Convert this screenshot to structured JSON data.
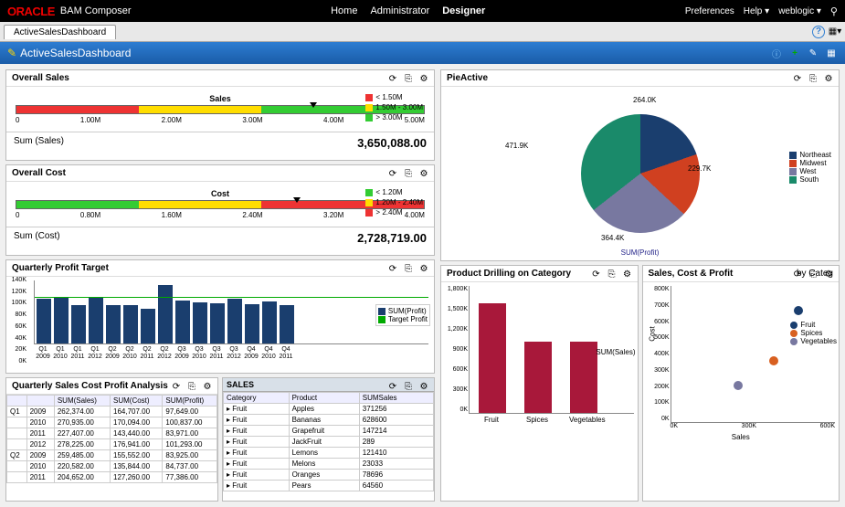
{
  "header": {
    "brand": "ORACLE",
    "product": "BAM Composer",
    "nav": [
      "Home",
      "Administrator",
      "Designer"
    ],
    "nav_active": 2,
    "right": {
      "prefs": "Preferences",
      "help": "Help",
      "user": "weblogic"
    }
  },
  "tab": {
    "name": "ActiveSalesDashboard"
  },
  "title": "ActiveSalesDashboard",
  "overall_sales": {
    "hdr": "Overall Sales",
    "gauge_title": "Sales",
    "ticks": [
      "0",
      "1.00M",
      "2.00M",
      "3.00M",
      "4.00M",
      "5.00M"
    ],
    "legend": [
      {
        "color": "#e33",
        "label": "< 1.50M"
      },
      {
        "color": "#fd0",
        "label": "1.50M - 3.00M"
      },
      {
        "color": "#3c3",
        "label": "> 3.00M"
      }
    ],
    "sum_lbl": "Sum (Sales)",
    "sum_val": "3,650,088.00"
  },
  "overall_cost": {
    "hdr": "Overall Cost",
    "gauge_title": "Cost",
    "ticks": [
      "0",
      "0.80M",
      "1.60M",
      "2.40M",
      "3.20M",
      "4.00M"
    ],
    "legend": [
      {
        "color": "#3c3",
        "label": "< 1.20M"
      },
      {
        "color": "#fd0",
        "label": "1.20M - 2.40M"
      },
      {
        "color": "#e33",
        "label": "> 2.40M"
      }
    ],
    "sum_lbl": "Sum (Cost)",
    "sum_val": "2,728,719.00"
  },
  "quarterly_profit": {
    "hdr": "Quarterly Profit Target",
    "legend": [
      {
        "color": "#1a3e6e",
        "label": "SUM(Profit)"
      },
      {
        "color": "#0a0",
        "label": "Target Profit"
      }
    ]
  },
  "qscp": {
    "hdr": "Quarterly Sales Cost Profit Analysis",
    "cols": [
      "",
      "",
      "SUM(Sales)",
      "SUM(Cost)",
      "SUM(Profit)"
    ],
    "rows": [
      [
        "Q1",
        "2009",
        "262,374.00",
        "164,707.00",
        "97,649.00"
      ],
      [
        "",
        "2010",
        "270,935.00",
        "170,094.00",
        "100,837.00"
      ],
      [
        "",
        "2011",
        "227,407.00",
        "143,440.00",
        "83,971.00"
      ],
      [
        "",
        "2012",
        "278,225.00",
        "176,941.00",
        "101,293.00"
      ],
      [
        "Q2",
        "2009",
        "259,485.00",
        "155,552.00",
        "83,925.00"
      ],
      [
        "",
        "2010",
        "220,582.00",
        "135,844.00",
        "84,737.00"
      ],
      [
        "",
        "2011",
        "204,652.00",
        "127,260.00",
        "77,386.00"
      ]
    ]
  },
  "sales_tbl": {
    "hdr": "SALES",
    "cols": [
      "Category",
      "Product",
      "SUMSales"
    ],
    "rows": [
      [
        "Fruit",
        "Apples",
        "371256"
      ],
      [
        "Fruit",
        "Bananas",
        "628600"
      ],
      [
        "Fruit",
        "Grapefruit",
        "147214"
      ],
      [
        "Fruit",
        "JackFruit",
        "289"
      ],
      [
        "Fruit",
        "Lemons",
        "121410"
      ],
      [
        "Fruit",
        "Melons",
        "23033"
      ],
      [
        "Fruit",
        "Oranges",
        "78696"
      ],
      [
        "Fruit",
        "Pears",
        "64560"
      ]
    ]
  },
  "pie": {
    "hdr": "PieActive",
    "sub": "SUM(Profit)",
    "labels": {
      "ne": "264.0K",
      "mw": "229.7K",
      "w": "364.4K",
      "s": "471.9K"
    },
    "legend": [
      {
        "color": "#1a3e6e",
        "label": "Northeast"
      },
      {
        "color": "#d04020",
        "label": "Midwest"
      },
      {
        "color": "#7878a0",
        "label": "West"
      },
      {
        "color": "#1a8a6a",
        "label": "South"
      }
    ]
  },
  "drill": {
    "hdr": "Product Drilling on Category",
    "yticks": [
      "1,800K",
      "1,500K",
      "1,200K",
      "900K",
      "600K",
      "300K",
      "0K"
    ],
    "legend": {
      "color": "#a8183a",
      "label": "SUM(Sales)"
    },
    "xlabels": [
      "Fruit",
      "Spices",
      "Vegetables"
    ]
  },
  "scatter": {
    "hdr": "Sales, Cost & Profit",
    "hdr2": "by Categ",
    "yticks": [
      "800K",
      "700K",
      "600K",
      "500K",
      "400K",
      "300K",
      "200K",
      "100K",
      "0K"
    ],
    "xticks": [
      "0K",
      "300K",
      "600K"
    ],
    "ylabel": "Cost",
    "xlabel": "Sales",
    "legend": [
      {
        "color": "#1a3e6e",
        "label": "Fruit"
      },
      {
        "color": "#d86020",
        "label": "Spices"
      },
      {
        "color": "#7878a0",
        "label": "Vegetables"
      }
    ]
  },
  "chart_data": [
    {
      "type": "bar",
      "title": "Quarterly Profit Target",
      "ylim": [
        0,
        140
      ],
      "target": 100,
      "categories": [
        "Q1 2009",
        "Q1 2010",
        "Q1 2011",
        "Q1 2012",
        "Q2 2009",
        "Q2 2010",
        "Q2 2011",
        "Q2 2012",
        "Q3 2009",
        "Q3 2010",
        "Q3 2011",
        "Q3 2012",
        "Q4 2009",
        "Q4 2010",
        "Q4 2011"
      ],
      "series": [
        {
          "name": "SUM(Profit)",
          "values": [
            98,
            101,
            84,
            101,
            84,
            85,
            77,
            128,
            94,
            90,
            88,
            99,
            86,
            92,
            84
          ]
        },
        {
          "name": "Target Profit",
          "values": [
            100,
            100,
            100,
            100,
            100,
            100,
            100,
            100,
            100,
            100,
            100,
            100,
            100,
            100,
            100
          ]
        }
      ]
    },
    {
      "type": "pie",
      "title": "PieActive",
      "series": [
        {
          "name": "SUM(Profit)",
          "values": [
            {
              "name": "Northeast",
              "value": 264.0
            },
            {
              "name": "Midwest",
              "value": 229.7
            },
            {
              "name": "West",
              "value": 364.4
            },
            {
              "name": "South",
              "value": 471.9
            }
          ]
        }
      ]
    },
    {
      "type": "bar",
      "title": "Product Drilling on Category",
      "ylim": [
        0,
        1800
      ],
      "categories": [
        "Fruit",
        "Spices",
        "Vegetables"
      ],
      "series": [
        {
          "name": "SUM(Sales)",
          "values": [
            1550,
            1000,
            1000
          ]
        }
      ]
    },
    {
      "type": "scatter",
      "title": "Sales, Cost & Profit by Category",
      "xlabel": "Sales",
      "ylabel": "Cost",
      "xlim": [
        0,
        600
      ],
      "ylim": [
        0,
        800
      ],
      "series": [
        {
          "name": "Fruit",
          "values": [
            [
              520,
              700
            ]
          ]
        },
        {
          "name": "Spices",
          "values": [
            [
              420,
              380
            ]
          ]
        },
        {
          "name": "Vegetables",
          "values": [
            [
              260,
              230
            ]
          ]
        }
      ]
    }
  ]
}
